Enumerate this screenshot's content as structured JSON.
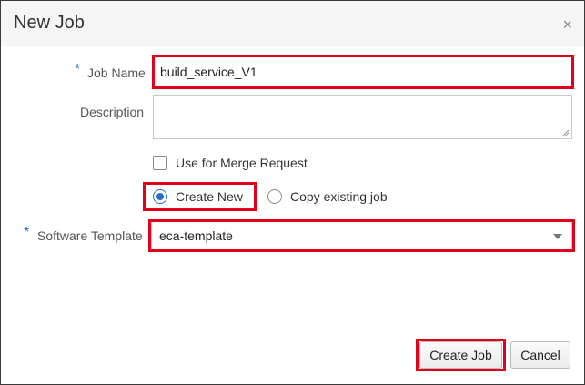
{
  "dialog": {
    "title": "New Job",
    "close_glyph": "×"
  },
  "form": {
    "job_name": {
      "label": "Job Name",
      "required_mark": "*",
      "value": "build_service_V1"
    },
    "description": {
      "label": "Description",
      "value": ""
    },
    "merge_request": {
      "label": "Use for Merge Request",
      "checked": false
    },
    "job_source": {
      "create_new_label": "Create New",
      "copy_existing_label": "Copy existing job",
      "selected": "create_new"
    },
    "software_template": {
      "label": "Software Template",
      "required_mark": "*",
      "value": "eca-template"
    }
  },
  "buttons": {
    "create_job": "Create Job",
    "cancel": "Cancel"
  },
  "colors": {
    "highlight": "#e2001a",
    "accent": "#2a6cc9",
    "title_bar": "#f5f5f5"
  }
}
